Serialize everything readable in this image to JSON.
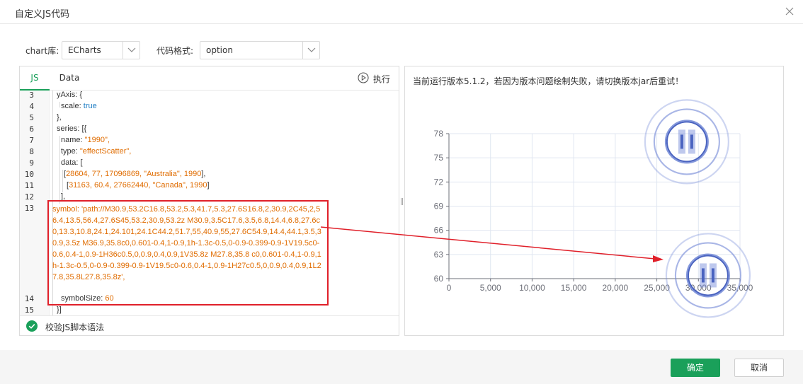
{
  "dialog": {
    "title": "自定义JS代码"
  },
  "options": {
    "chart_lib_label": "chart库:",
    "chart_lib_value": "ECharts",
    "code_format_label": "代码格式:",
    "code_format_value": "option"
  },
  "editor": {
    "tabs": [
      {
        "label": "JS",
        "active": true
      },
      {
        "label": "Data",
        "active": false
      }
    ],
    "run_label": "执行",
    "validate_label": "校验JS脚本语法",
    "line_numbers": [
      "3",
      "4",
      "5",
      "6",
      "7",
      "8",
      "9",
      "10",
      "11",
      "12",
      "13",
      "14",
      "15"
    ],
    "lines": {
      "l3": "yAxis: {",
      "l4_key": "scale: ",
      "l4_val": "true",
      "l5": "},",
      "l6": "series: [{",
      "l7_key": "name: ",
      "l7_val": "\"1990\",",
      "l8_key": "type: ",
      "l8_val": "\"effectScatter\",",
      "l9": "data: [",
      "l10_open": "[",
      "l10_vals": "28604, 77, 17096869, \"Australia\", 1990",
      "l10_close": "],",
      "l11_open": "[",
      "l11_vals": "31163, 60.4, 27662440, \"Canada\", 1990",
      "l11_close": "]",
      "l12": "],",
      "l13": "symbol: 'path://M30.9,53.2C16.8,53.2,5.3,41.7,5.3,27.6S16.8,2,30.9,2C45,2,56.4,13.5,56.4,27.6S45,53.2,30.9,53.2z M30.9,3.5C17.6,3.5,6.8,14.4,6.8,27.6c0,13.3,10.8,24.1,24.101,24.1C44.2,51.7,55,40.9,55,27.6C54.9,14.4,44.1,3.5,30.9,3.5z M36.9,35.8c0,0.601-0.4,1-0.9,1h-1.3c-0.5,0-0.9-0.399-0.9-1V19.5c0-0.6,0.4-1,0.9-1H36c0.5,0,0.9,0.4,0.9,1V35.8z M27.8,35.8 c0,0.601-0.4,1-0.9,1h-1.3c-0.5,0-0.9-0.399-0.9-1V19.5c0-0.6,0.4-1,0.9-1H27c0.5,0,0.9,0.4,0.9,1L27.8,35.8L27.8,35.8z',",
      "l14_key": "symbolSize: ",
      "l14_val": "60",
      "l15": "}]"
    }
  },
  "preview": {
    "note": "当前运行版本5.1.2，若因为版本问题绘制失败，请切换版本jar后重试！"
  },
  "chart_data": {
    "type": "scatter",
    "x_ticks": [
      "0",
      "5,000",
      "10,000",
      "15,000",
      "20,000",
      "25,000",
      "30,000",
      "35,000"
    ],
    "y_ticks": [
      "60",
      "63",
      "66",
      "69",
      "72",
      "75",
      "78"
    ],
    "xlim": [
      0,
      35000
    ],
    "ylim": [
      60,
      78
    ],
    "grid": true,
    "series": [
      {
        "name": "1990",
        "points": [
          {
            "x": 28604,
            "y": 77,
            "size": 17096869,
            "label": "Australia",
            "year": 1990
          },
          {
            "x": 31163,
            "y": 60.4,
            "size": 27662440,
            "label": "Canada",
            "year": 1990
          }
        ]
      }
    ],
    "colors": {
      "symbol": "#4a63c0",
      "ripple": "#6f86d6",
      "axis": "#6e7079",
      "grid": "#e0e6f1"
    }
  },
  "footer": {
    "ok_label": "确定",
    "cancel_label": "取消"
  },
  "colors": {
    "primary": "#1aa05a",
    "annotation": "#e0202a"
  }
}
